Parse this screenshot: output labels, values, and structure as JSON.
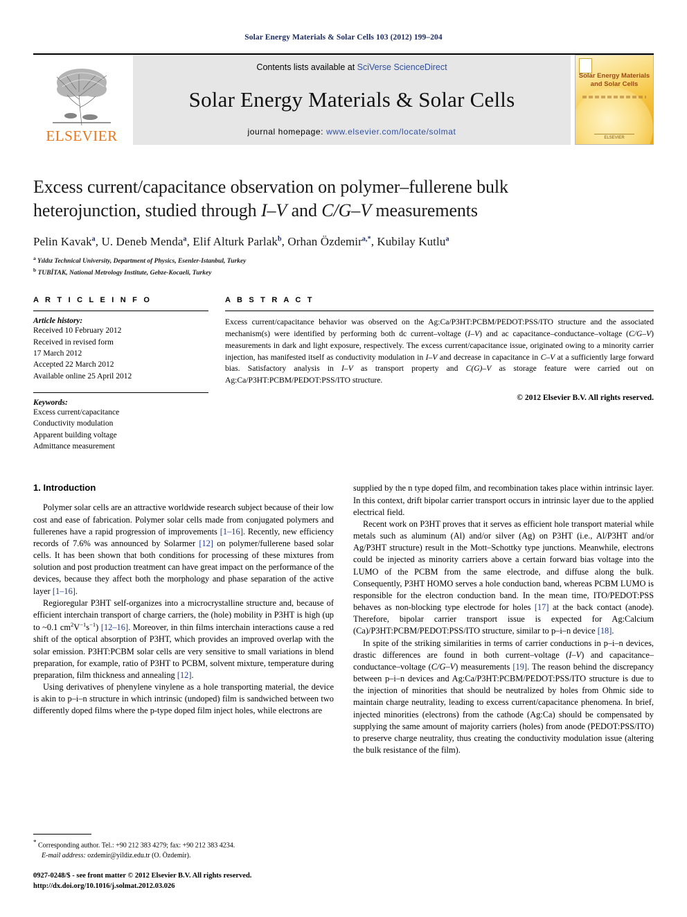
{
  "running_head": "Solar Energy Materials & Solar Cells 103 (2012) 199–204",
  "masthead": {
    "contents_prefix": "Contents lists available at ",
    "contents_link": "SciVerse ScienceDirect",
    "journal_title": "Solar Energy Materials & Solar Cells",
    "homepage_prefix": "journal homepage: ",
    "homepage_url": "www.elsevier.com/locate/solmat",
    "publisher": "ELSEVIER",
    "cover_title_line1": "Solar Energy Materials",
    "cover_title_line2": "and Solar Cells",
    "cover_footer": "ELSEVIER"
  },
  "article": {
    "title_line1": "Excess current/capacitance observation on polymer–fullerene bulk",
    "title_line2_a": "heterojunction, studied through ",
    "title_line2_i1": "I–V",
    "title_line2_b": " and ",
    "title_line2_i2": "C/G–V",
    "title_line2_c": " measurements",
    "authors": [
      {
        "name": "Pelin Kavak",
        "sup": "a",
        "sep": ", "
      },
      {
        "name": "U. Deneb Menda",
        "sup": "a",
        "sep": ", "
      },
      {
        "name": "Elif Alturk Parlak",
        "sup": "b",
        "sep": ", "
      },
      {
        "name": "Orhan Özdemir",
        "sup": "a,*",
        "sep": ", "
      },
      {
        "name": "Kubilay Kutlu",
        "sup": "a",
        "sep": ""
      }
    ],
    "affiliations": [
      {
        "marker": "a",
        "text": "Yıldız Technical University, Department of Physics, Esenler-Istanbul, Turkey"
      },
      {
        "marker": "b",
        "text": "TUBİTAK, National Metrology Institute, Gebze-Kocaeli, Turkey"
      }
    ]
  },
  "info": {
    "heading": "A R T I C L E   I N F O",
    "history_label": "Article history:",
    "history": [
      "Received 10 February 2012",
      "Received in revised form",
      "17 March 2012",
      "Accepted 22 March 2012",
      "Available online 25 April 2012"
    ],
    "keywords_label": "Keywords:",
    "keywords": [
      "Excess current/capacitance",
      "Conductivity modulation",
      "Apparent building voltage",
      "Admittance measurement"
    ]
  },
  "abstract": {
    "heading": "A B S T R A C T",
    "parts": [
      {
        "t": "text",
        "v": "Excess current/capacitance behavior was observed on the Ag:Ca/P3HT:PCBM/PEDOT:PSS/ITO structure and the associated mechanism(s) were identified by performing both dc current–voltage ("
      },
      {
        "t": "i",
        "v": "I–V"
      },
      {
        "t": "text",
        "v": ") and ac capacitance–conductance–voltage ("
      },
      {
        "t": "i",
        "v": "C/G–V"
      },
      {
        "t": "text",
        "v": ") measurements in dark and light exposure, respectively. The excess current/capacitance issue, originated owing to a minority carrier injection, has manifested itself as conductivity modulation in "
      },
      {
        "t": "i",
        "v": "I–V"
      },
      {
        "t": "text",
        "v": " and decrease in capacitance in "
      },
      {
        "t": "i",
        "v": "C–V"
      },
      {
        "t": "text",
        "v": " at a sufficiently large forward bias. Satisfactory analysis in "
      },
      {
        "t": "i",
        "v": "I–V"
      },
      {
        "t": "text",
        "v": " as transport property and "
      },
      {
        "t": "i",
        "v": "C(G)–V"
      },
      {
        "t": "text",
        "v": " as storage feature were carried out on Ag:Ca/P3HT:PCBM/PEDOT:PSS/ITO structure."
      }
    ],
    "copyright": "© 2012 Elsevier B.V. All rights reserved."
  },
  "body": {
    "section_title": "1.  Introduction",
    "left_paragraphs": [
      "Polymer solar cells are an attractive worldwide research subject because of their low cost and ease of fabrication. Polymer solar cells made from conjugated polymers and fullerenes have a rapid progression of improvements [1–16]. Recently, new efficiency records of 7.6% was announced by Solarmer [12] on polymer/fullerene based solar cells. It has been shown that both conditions for processing of these mixtures from solution and post production treatment can have great impact on the performance of the devices, because they affect both the morphology and phase separation of the active layer [1–16].",
      "Regioregular P3HT self-organizes into a microcrystalline structure and, because of efficient interchain transport of charge carriers, the (hole) mobility in P3HT is high (up to ~0.1 cm2 V−1s−1) [12–16]. Moreover, in thin films interchain interactions cause a red shift of the optical absorption of P3HT, which provides an improved overlap with the solar emission. P3HT:PCBM solar cells are very sensitive to small variations in blend preparation, for example, ratio of P3HT to PCBM, solvent mixture, temperature during preparation, film thickness and annealing [12].",
      "Using derivatives of phenylene vinylene as a hole transporting material, the device is akin to p–i–n structure in which intrinsic (undoped) film is sandwiched between two differently doped films where the p-type doped film inject holes, while electrons are"
    ],
    "right_paragraphs": [
      "supplied by the n type doped film, and recombination takes place within intrinsic layer. In this context, drift bipolar carrier transport occurs in intrinsic layer due to the applied electrical field.",
      "Recent work on P3HT proves that it serves as efficient hole transport material while metals such as aluminum (Al) and/or silver (Ag) on P3HT (i.e., Al/P3HT and/or Ag/P3HT structure) result in the Mott–Schottky type junctions. Meanwhile, electrons could be injected as minority carriers above a certain forward bias voltage into the LUMO of the PCBM from the same electrode, and diffuse along the bulk. Consequently, P3HT HOMO serves a hole conduction band, whereas PCBM LUMO is responsible for the electron conduction band. In the mean time, ITO/PEDOT:PSS behaves as non-blocking type electrode for holes [17] at the back contact (anode). Therefore, bipolar carrier transport issue is expected for Ag:Calcium (Ca)/P3HT:PCBM/PEDOT:PSS/ITO structure, similar to p–i–n device [18].",
      "In spite of the striking similarities in terms of carrier conductions in p–i–n devices, drastic differences are found in both current–voltage (I–V) and capacitance–conductance–voltage (C/G–V) measurements [19]. The reason behind the discrepancy between p–i–n devices and Ag:Ca/P3HT:PCBM/PEDOT:PSS/ITO structure is due to the injection of minorities that should be neutralized by holes from Ohmic side to maintain charge neutrality, leading to excess current/capacitance phenomena. In brief, injected minorities (electrons) from the cathode (Ag:Ca) should be compensated by supplying the same amount of majority carriers (holes) from anode (PEDOT:PSS/ITO) to preserve charge neutrality, thus creating the conductivity modulation issue (altering the bulk resistance of the film)."
    ]
  },
  "footnotes": {
    "corresponding": "Corresponding author. Tel.: +90 212 383 4279; fax: +90 212 383 4234.",
    "email_label": "E-mail address:",
    "email_value": "ozdemir@yildiz.edu.tr (O. Özdemir).",
    "issn_line": "0927-0248/$ - see front matter © 2012 Elsevier B.V. All rights reserved.",
    "doi_line": "http://dx.doi.org/10.1016/j.solmat.2012.03.026"
  }
}
